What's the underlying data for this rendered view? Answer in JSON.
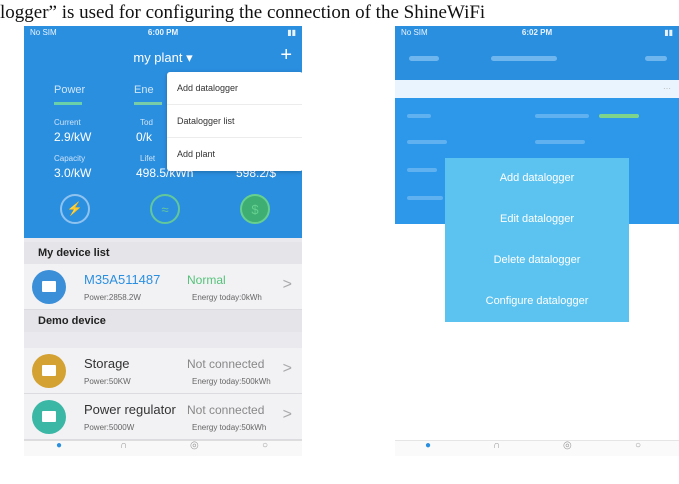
{
  "caption": "logger” is used for configuring the connection of the ShineWiFi",
  "left": {
    "status": {
      "carrier": "No SIM",
      "time": "6:00 PM"
    },
    "nav": {
      "title": "my plant ▾",
      "add": "+"
    },
    "tabs": {
      "power": "Power",
      "energy": "Ene"
    },
    "stats": {
      "current_label": "Current",
      "current_value": "2.9/kW",
      "today_label": "Tod",
      "today_value": "0/k",
      "capacity_label": "Capacity",
      "capacity_value": "3.0/kW",
      "lifetime_label": "Lifet",
      "lifetime_value": "498.5/kWh",
      "revenue_value": "598.2/$"
    },
    "menu": [
      "Add datalogger",
      "Datalogger list",
      "Add plant"
    ],
    "sections": {
      "my_devices": "My device list",
      "demo": "Demo device"
    },
    "devices": [
      {
        "name": "M35A511487",
        "power": "Power:2858.2W",
        "status": "Normal",
        "energy": "Energy today:0kWh",
        "color": "#3b8fd8",
        "status_color": "#56c27a",
        "name_color": "#2b8fe0"
      },
      {
        "name": "Storage",
        "power": "Power:50KW",
        "status": "Not connected",
        "energy": "Energy today:500kWh",
        "color": "#d3a233",
        "status_color": "#999999",
        "name_color": "#333333"
      },
      {
        "name": "Power regulator",
        "power": "Power:5000W",
        "status": "Not connected",
        "energy": "Energy today:50kWh",
        "color": "#3bb7a6",
        "status_color": "#999999",
        "name_color": "#333333"
      }
    ],
    "accent": "#2b8fe0"
  },
  "right": {
    "status": {
      "carrier": "No SIM",
      "time": "6:02 PM"
    },
    "menu": [
      "Add datalogger",
      "Edit datalogger",
      "Delete datalogger",
      "Configure datalogger"
    ],
    "modal_color": "#5cc3f1"
  }
}
